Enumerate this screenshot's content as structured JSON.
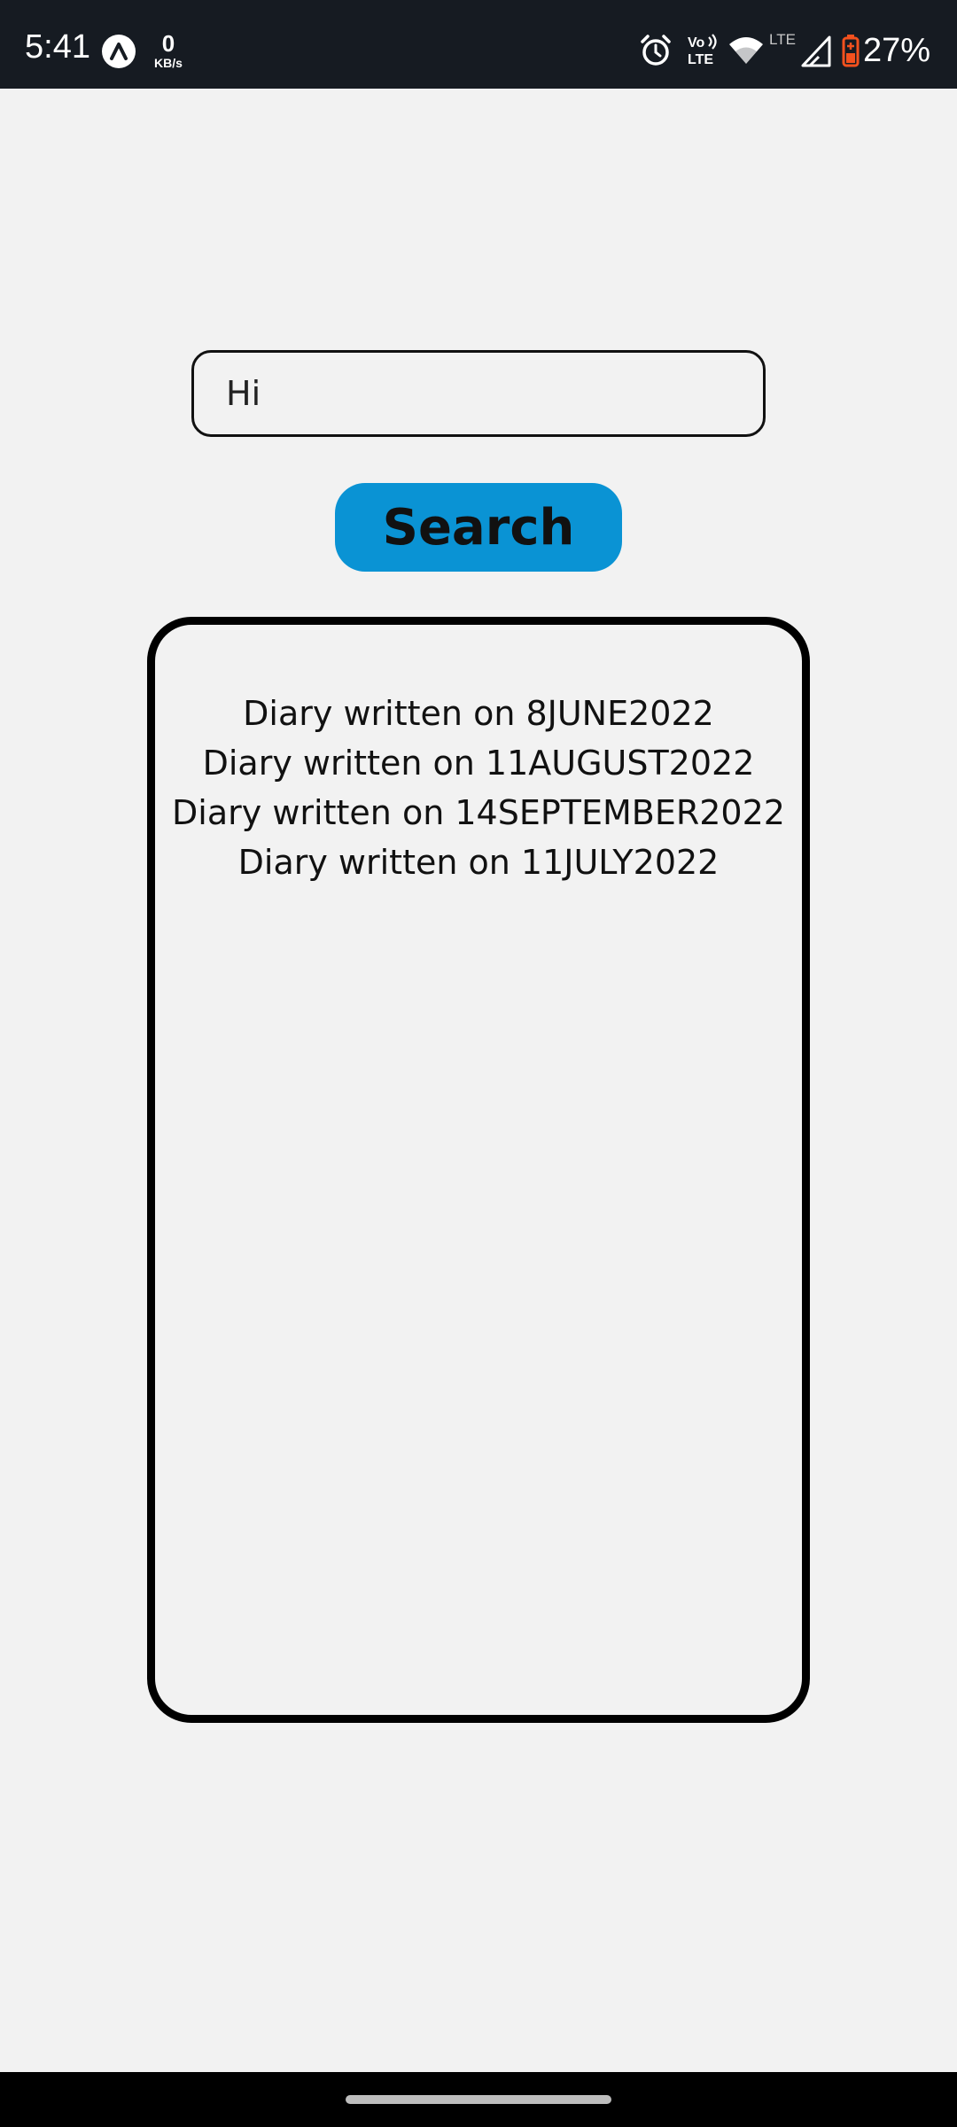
{
  "status_bar": {
    "time": "5:41",
    "net_speed_value": "0",
    "net_speed_unit": "KB/s",
    "battery_percent": "27%",
    "icons": [
      "app-icon",
      "alarm-icon",
      "volte-icon",
      "wifi-icon",
      "lte-signal-icon",
      "battery-icon"
    ],
    "volte_label_top": "Vo",
    "volte_label_bottom": "LTE",
    "lte_label": "LTE",
    "battery_color": "#f4511e"
  },
  "search": {
    "value": "Hi",
    "button_label": "Search",
    "button_color": "#0a93d4"
  },
  "results": {
    "items": [
      "Diary written on 8JUNE2022",
      "Diary written on 11AUGUST2022",
      "Diary written on 14SEPTEMBER2022",
      "Diary written on 11JULY2022"
    ]
  }
}
